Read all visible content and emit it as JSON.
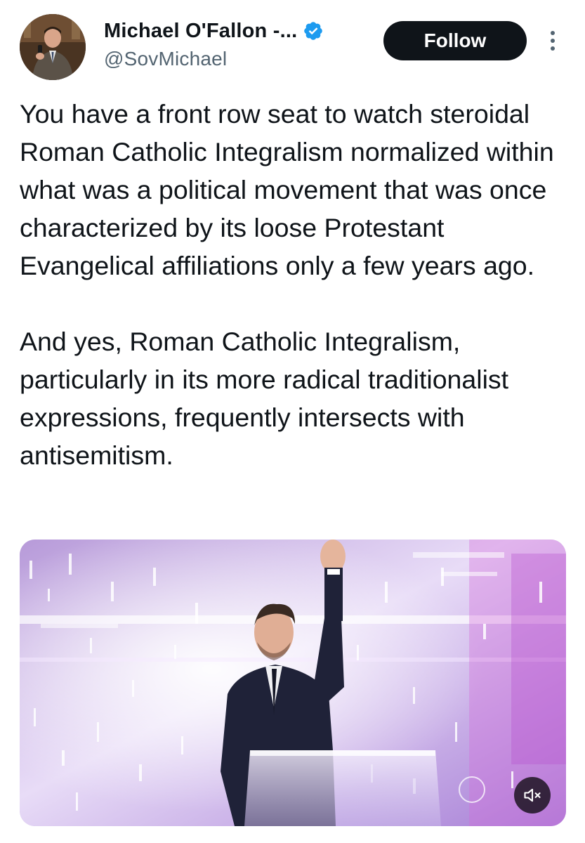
{
  "user": {
    "display_name": "Michael O'Fallon -...",
    "handle": "@SovMichael",
    "verified": true,
    "avatar_icon": "profile-photo"
  },
  "actions": {
    "follow_label": "Follow",
    "more_icon": "vertical-ellipsis-icon"
  },
  "tweet": {
    "paragraphs": [
      "You have a front row seat to watch steroidal Roman Catholic Integralism normalized within what was a political movement that was once characterized by its loose Protestant Evangelical affiliations only a few years ago.",
      "And yes, Roman Catholic Integralism, particularly in its more radical traditionalist expressions, frequently intersects with antisemitism."
    ]
  },
  "media": {
    "type": "video",
    "mute_icon": "speaker-muted-icon"
  },
  "colors": {
    "text": "#0f1419",
    "secondary": "#536471",
    "verified_blue": "#1d9bf0",
    "follow_bg": "#0f1419",
    "follow_text": "#ffffff"
  }
}
